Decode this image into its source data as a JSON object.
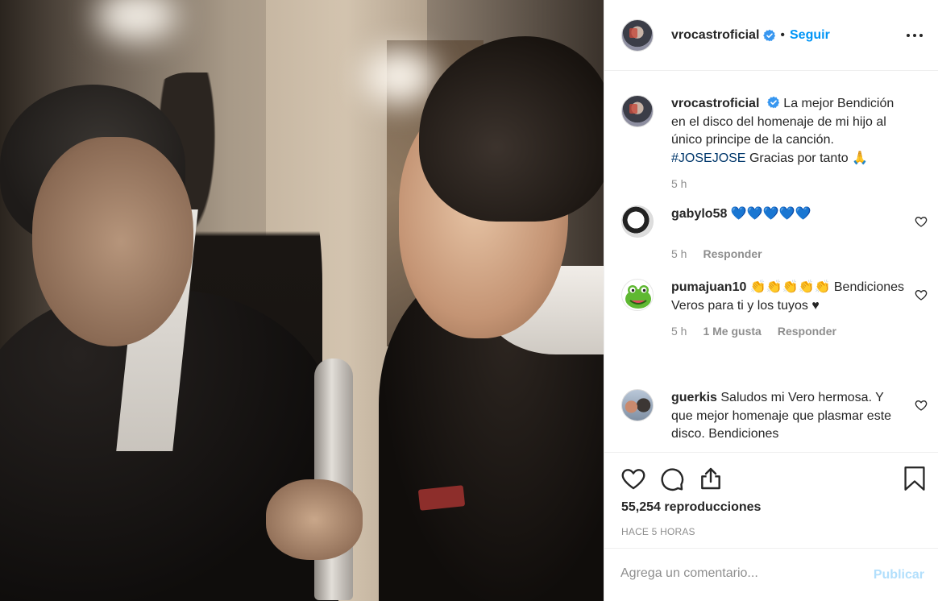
{
  "post": {
    "username": "vrocastroficial",
    "follow_label": "Seguir",
    "separator": "•",
    "caption": {
      "text_before_tag": "La mejor Bendición en el disco del homenaje de mi hijo al único principe de la canción.",
      "hashtag": "#JOSEJOSE",
      "text_after_tag": "Gracias por tanto 🙏",
      "time": "5 h"
    },
    "comments": [
      {
        "username": "gabylo58",
        "text": "💙💙💙💙💙",
        "time": "5 h",
        "likes": "",
        "reply_label": "Responder"
      },
      {
        "username": "pumajuan10",
        "text": "👏👏👏👏👏 Bendiciones Veros para ti y los tuyos ♥",
        "time": "5 h",
        "likes": "1 Me gusta",
        "reply_label": "Responder"
      },
      {
        "username": "guerkis",
        "text": "Saludos mi Vero hermosa. Y que mejor homenaje que plasmar este disco. Bendiciones",
        "time": "",
        "likes": "",
        "reply_label": ""
      }
    ],
    "views": "55,254 reproducciones",
    "posted_ago": "HACE 5 HORAS",
    "comment_input": {
      "placeholder": "Agrega un comentario..."
    },
    "publish_label": "Publicar"
  },
  "icons": {
    "verified": "verified-badge-icon",
    "more": "more-options-icon",
    "like": "heart-icon",
    "comment": "comment-icon",
    "share": "share-icon",
    "save": "bookmark-icon"
  },
  "colors": {
    "accent": "#0095f6",
    "text": "#262626",
    "muted": "#8e8e8e",
    "hashtag": "#00376b",
    "publish_disabled": "#b2dffc"
  }
}
